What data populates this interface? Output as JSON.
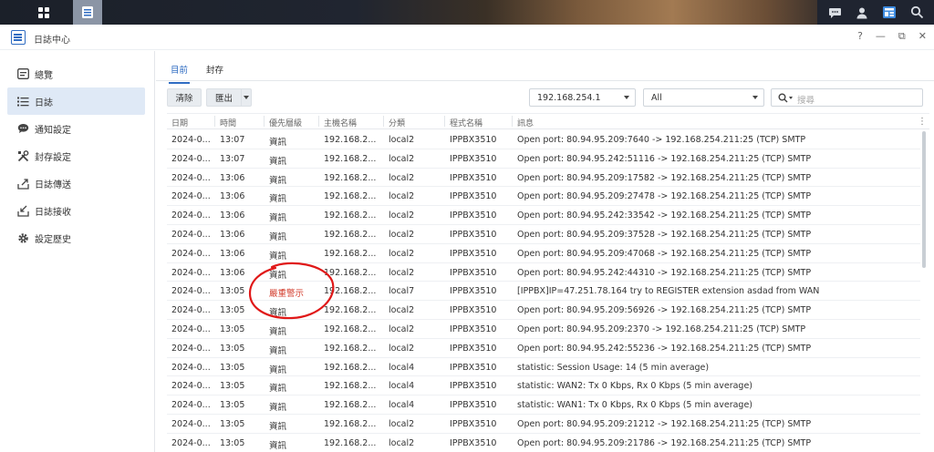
{
  "window": {
    "title": "日誌中心",
    "controls": [
      "?",
      "—",
      "⧉",
      "✕"
    ]
  },
  "taskbar": {
    "icons": [
      "apps-grid-icon",
      "log-center-icon",
      "chat-icon",
      "user-icon",
      "widgets-icon",
      "search-icon"
    ]
  },
  "sidebar": {
    "items": [
      {
        "label": "總覽",
        "icon": "overview-icon",
        "active": false
      },
      {
        "label": "日誌",
        "icon": "list-icon",
        "active": true
      },
      {
        "label": "通知設定",
        "icon": "chat-bubble-icon",
        "active": false
      },
      {
        "label": "封存設定",
        "icon": "tools-icon",
        "active": false
      },
      {
        "label": "日誌傳送",
        "icon": "upload-icon",
        "active": false
      },
      {
        "label": "日誌接收",
        "icon": "download-icon",
        "active": false
      },
      {
        "label": "設定歷史",
        "icon": "gear-icon",
        "active": false
      }
    ]
  },
  "tabs": [
    {
      "label": "目前",
      "active": true
    },
    {
      "label": "封存",
      "active": false
    }
  ],
  "toolbar": {
    "clear_label": "清除",
    "export_label": "匯出",
    "host_select": "192.168.254.1",
    "category_select": "All",
    "search_placeholder": "搜尋"
  },
  "table": {
    "headers": [
      "日期",
      "時間",
      "優先層級",
      "主機名稱",
      "分類",
      "程式名稱",
      "訊息"
    ],
    "rows": [
      {
        "date": "2024-0...",
        "time": "13:07",
        "level": "資訊",
        "host": "192.168.2...",
        "category": "local2",
        "program": "IPPBX3510",
        "message": "Open port: 80.94.95.209:7640 -> 192.168.254.211:25 (TCP) SMTP"
      },
      {
        "date": "2024-0...",
        "time": "13:07",
        "level": "資訊",
        "host": "192.168.2...",
        "category": "local2",
        "program": "IPPBX3510",
        "message": "Open port: 80.94.95.242:51116 -> 192.168.254.211:25 (TCP) SMTP"
      },
      {
        "date": "2024-0...",
        "time": "13:06",
        "level": "資訊",
        "host": "192.168.2...",
        "category": "local2",
        "program": "IPPBX3510",
        "message": "Open port: 80.94.95.209:17582 -> 192.168.254.211:25 (TCP) SMTP"
      },
      {
        "date": "2024-0...",
        "time": "13:06",
        "level": "資訊",
        "host": "192.168.2...",
        "category": "local2",
        "program": "IPPBX3510",
        "message": "Open port: 80.94.95.209:27478 -> 192.168.254.211:25 (TCP) SMTP"
      },
      {
        "date": "2024-0...",
        "time": "13:06",
        "level": "資訊",
        "host": "192.168.2...",
        "category": "local2",
        "program": "IPPBX3510",
        "message": "Open port: 80.94.95.242:33542 -> 192.168.254.211:25 (TCP) SMTP"
      },
      {
        "date": "2024-0...",
        "time": "13:06",
        "level": "資訊",
        "host": "192.168.2...",
        "category": "local2",
        "program": "IPPBX3510",
        "message": "Open port: 80.94.95.209:37528 -> 192.168.254.211:25 (TCP) SMTP"
      },
      {
        "date": "2024-0...",
        "time": "13:06",
        "level": "資訊",
        "host": "192.168.2...",
        "category": "local2",
        "program": "IPPBX3510",
        "message": "Open port: 80.94.95.209:47068 -> 192.168.254.211:25 (TCP) SMTP"
      },
      {
        "date": "2024-0...",
        "time": "13:06",
        "level": "資訊",
        "host": "192.168.2...",
        "category": "local2",
        "program": "IPPBX3510",
        "message": "Open port: 80.94.95.242:44310 -> 192.168.254.211:25 (TCP) SMTP"
      },
      {
        "date": "2024-0...",
        "time": "13:05",
        "level": "嚴重警示",
        "host": "192.168.2...",
        "category": "local7",
        "program": "IPPBX3510",
        "message": "[IPPBX]IP=47.251.78.164 try to REGISTER extension asdad from WAN",
        "critical": true
      },
      {
        "date": "2024-0...",
        "time": "13:05",
        "level": "資訊",
        "host": "192.168.2...",
        "category": "local2",
        "program": "IPPBX3510",
        "message": "Open port: 80.94.95.209:56926 -> 192.168.254.211:25 (TCP) SMTP"
      },
      {
        "date": "2024-0...",
        "time": "13:05",
        "level": "資訊",
        "host": "192.168.2...",
        "category": "local2",
        "program": "IPPBX3510",
        "message": "Open port: 80.94.95.209:2370 -> 192.168.254.211:25 (TCP) SMTP"
      },
      {
        "date": "2024-0...",
        "time": "13:05",
        "level": "資訊",
        "host": "192.168.2...",
        "category": "local2",
        "program": "IPPBX3510",
        "message": "Open port: 80.94.95.242:55236 -> 192.168.254.211:25 (TCP) SMTP"
      },
      {
        "date": "2024-0...",
        "time": "13:05",
        "level": "資訊",
        "host": "192.168.2...",
        "category": "local4",
        "program": "IPPBX3510",
        "message": "statistic: Session Usage: 14 (5 min average)"
      },
      {
        "date": "2024-0...",
        "time": "13:05",
        "level": "資訊",
        "host": "192.168.2...",
        "category": "local4",
        "program": "IPPBX3510",
        "message": "statistic: WAN2: Tx 0 Kbps, Rx 0 Kbps (5 min average)"
      },
      {
        "date": "2024-0...",
        "time": "13:05",
        "level": "資訊",
        "host": "192.168.2...",
        "category": "local4",
        "program": "IPPBX3510",
        "message": "statistic: WAN1: Tx 0 Kbps, Rx 0 Kbps (5 min average)"
      },
      {
        "date": "2024-0...",
        "time": "13:05",
        "level": "資訊",
        "host": "192.168.2...",
        "category": "local2",
        "program": "IPPBX3510",
        "message": "Open port: 80.94.95.209:21212 -> 192.168.254.211:25 (TCP) SMTP"
      },
      {
        "date": "2024-0...",
        "time": "13:05",
        "level": "資訊",
        "host": "192.168.2...",
        "category": "local2",
        "program": "IPPBX3510",
        "message": "Open port: 80.94.95.209:21786 -> 192.168.254.211:25 (TCP) SMTP"
      }
    ]
  },
  "colors": {
    "accent": "#2f6cc2",
    "critical": "#d23a2a",
    "annotation": "#e01818"
  }
}
